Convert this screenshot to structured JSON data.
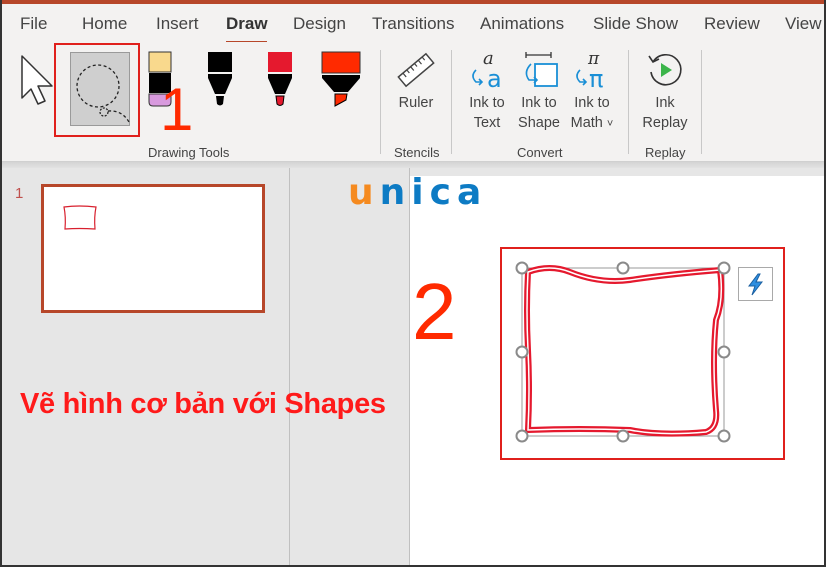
{
  "ribbon_tabs": [
    {
      "label": "File",
      "active": false
    },
    {
      "label": "Home",
      "active": false
    },
    {
      "label": "Insert",
      "active": false
    },
    {
      "label": "Draw",
      "active": true
    },
    {
      "label": "Design",
      "active": false
    },
    {
      "label": "Transitions",
      "active": false
    },
    {
      "label": "Animations",
      "active": false
    },
    {
      "label": "Slide Show",
      "active": false
    },
    {
      "label": "Review",
      "active": false
    },
    {
      "label": "View",
      "active": false
    }
  ],
  "groups": {
    "drawing_tools": {
      "label": "Drawing Tools",
      "tools": [
        {
          "name": "select",
          "icon": "cursor-arrow-icon"
        },
        {
          "name": "lasso-select",
          "icon": "lasso-select-icon",
          "selected": true
        },
        {
          "name": "eraser",
          "icon": "eraser-pen-icon",
          "color": "#f9d98d"
        },
        {
          "name": "pen-black",
          "icon": "pen-icon",
          "color": "#000000"
        },
        {
          "name": "pen-red",
          "icon": "pen-icon",
          "color": "#e5192e"
        },
        {
          "name": "highlighter",
          "icon": "highlighter-icon",
          "color": "#ff2a00"
        }
      ]
    },
    "stencils": {
      "label": "Stencils",
      "buttons": [
        {
          "label_line1": "Ruler",
          "label_line2": "",
          "icon": "ruler-icon"
        }
      ]
    },
    "convert": {
      "label": "Convert",
      "buttons": [
        {
          "label_line1": "Ink to",
          "label_line2": "Text",
          "icon": "ink-to-text-icon"
        },
        {
          "label_line1": "Ink to",
          "label_line2": "Shape",
          "icon": "ink-to-shape-icon"
        },
        {
          "label_line1": "Ink to",
          "label_line2": "Math",
          "icon": "ink-to-math-icon",
          "dropdown": "˅"
        }
      ]
    },
    "replay": {
      "label": "Replay",
      "buttons": [
        {
          "label_line1": "Ink",
          "label_line2": "Replay",
          "icon": "ink-replay-icon"
        }
      ]
    }
  },
  "annotations": {
    "step1": "1",
    "step2": "2",
    "caption": "Vẽ hình cơ bản với Shapes",
    "highlight_color": "#e0201c",
    "number_color": "#ff2a00"
  },
  "logo": {
    "part1": "u",
    "part2": "nica",
    "color1": "#f58a1f",
    "color2": "#0d7bc4"
  },
  "slides_pane": {
    "slides": [
      {
        "number": "1",
        "selected": true
      }
    ]
  },
  "colors": {
    "accent": "#b7472a",
    "ink_red": "#e5192e",
    "ribbon_bg": "#f3f2f1",
    "pane_bg": "#e6e6e6"
  }
}
